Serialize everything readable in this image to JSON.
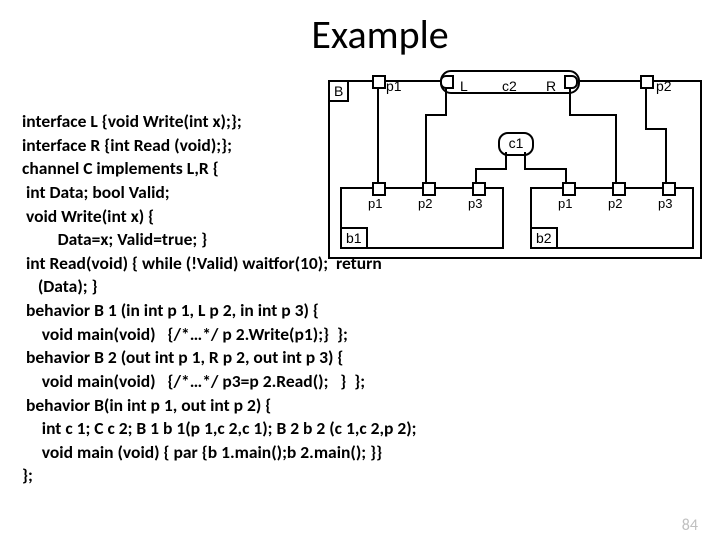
{
  "title": "Example",
  "page_number": "84",
  "code": {
    "l1": "interface L {void Write(int x);};",
    "l2": "interface R {int Read (void);};",
    "l3": "channel C implements L,R {",
    "l4": " int Data; bool Valid;",
    "l5": " void Write(int x) {",
    "l6": "         Data=x; Valid=true; }",
    "l7": " int Read(void) { while (!Valid) waitfor(10);  return",
    "l8": "    (Data); }",
    "l9": " behavior B 1 (in int p 1, L p 2, in int p 3) {",
    "l10": "     void main(void)   {/*…*/ p 2.Write(p1);}  };",
    "l11": " behavior B 2 (out int p 1, R p 2, out int p 3) {",
    "l12": "     void main(void)   {/*…*/ p3=p 2.Read();   }  };",
    "l13": " behavior B(in int p 1, out int p 2) {",
    "l14": "     int c 1; C c 2; B 1 b 1(p 1,c 2,c 1); B 2 b 2 (c 1,c 2,p 2);",
    "l15": "     void main (void) { par {b 1.main();b 2.main(); }}",
    "l16": "};"
  },
  "diagram": {
    "outer_tab": "B",
    "top_p1": "p1",
    "top_p2": "p2",
    "pill_l": "L",
    "pill_c2": "c2",
    "pill_r": "R",
    "oval_c1": "c1",
    "b1_tab": "b1",
    "b2_tab": "b2",
    "b1_p1": "p1",
    "b1_p2": "p2",
    "b1_p3": "p3",
    "b2_p1": "p1",
    "b2_p2": "p2",
    "b2_p3": "p3"
  }
}
